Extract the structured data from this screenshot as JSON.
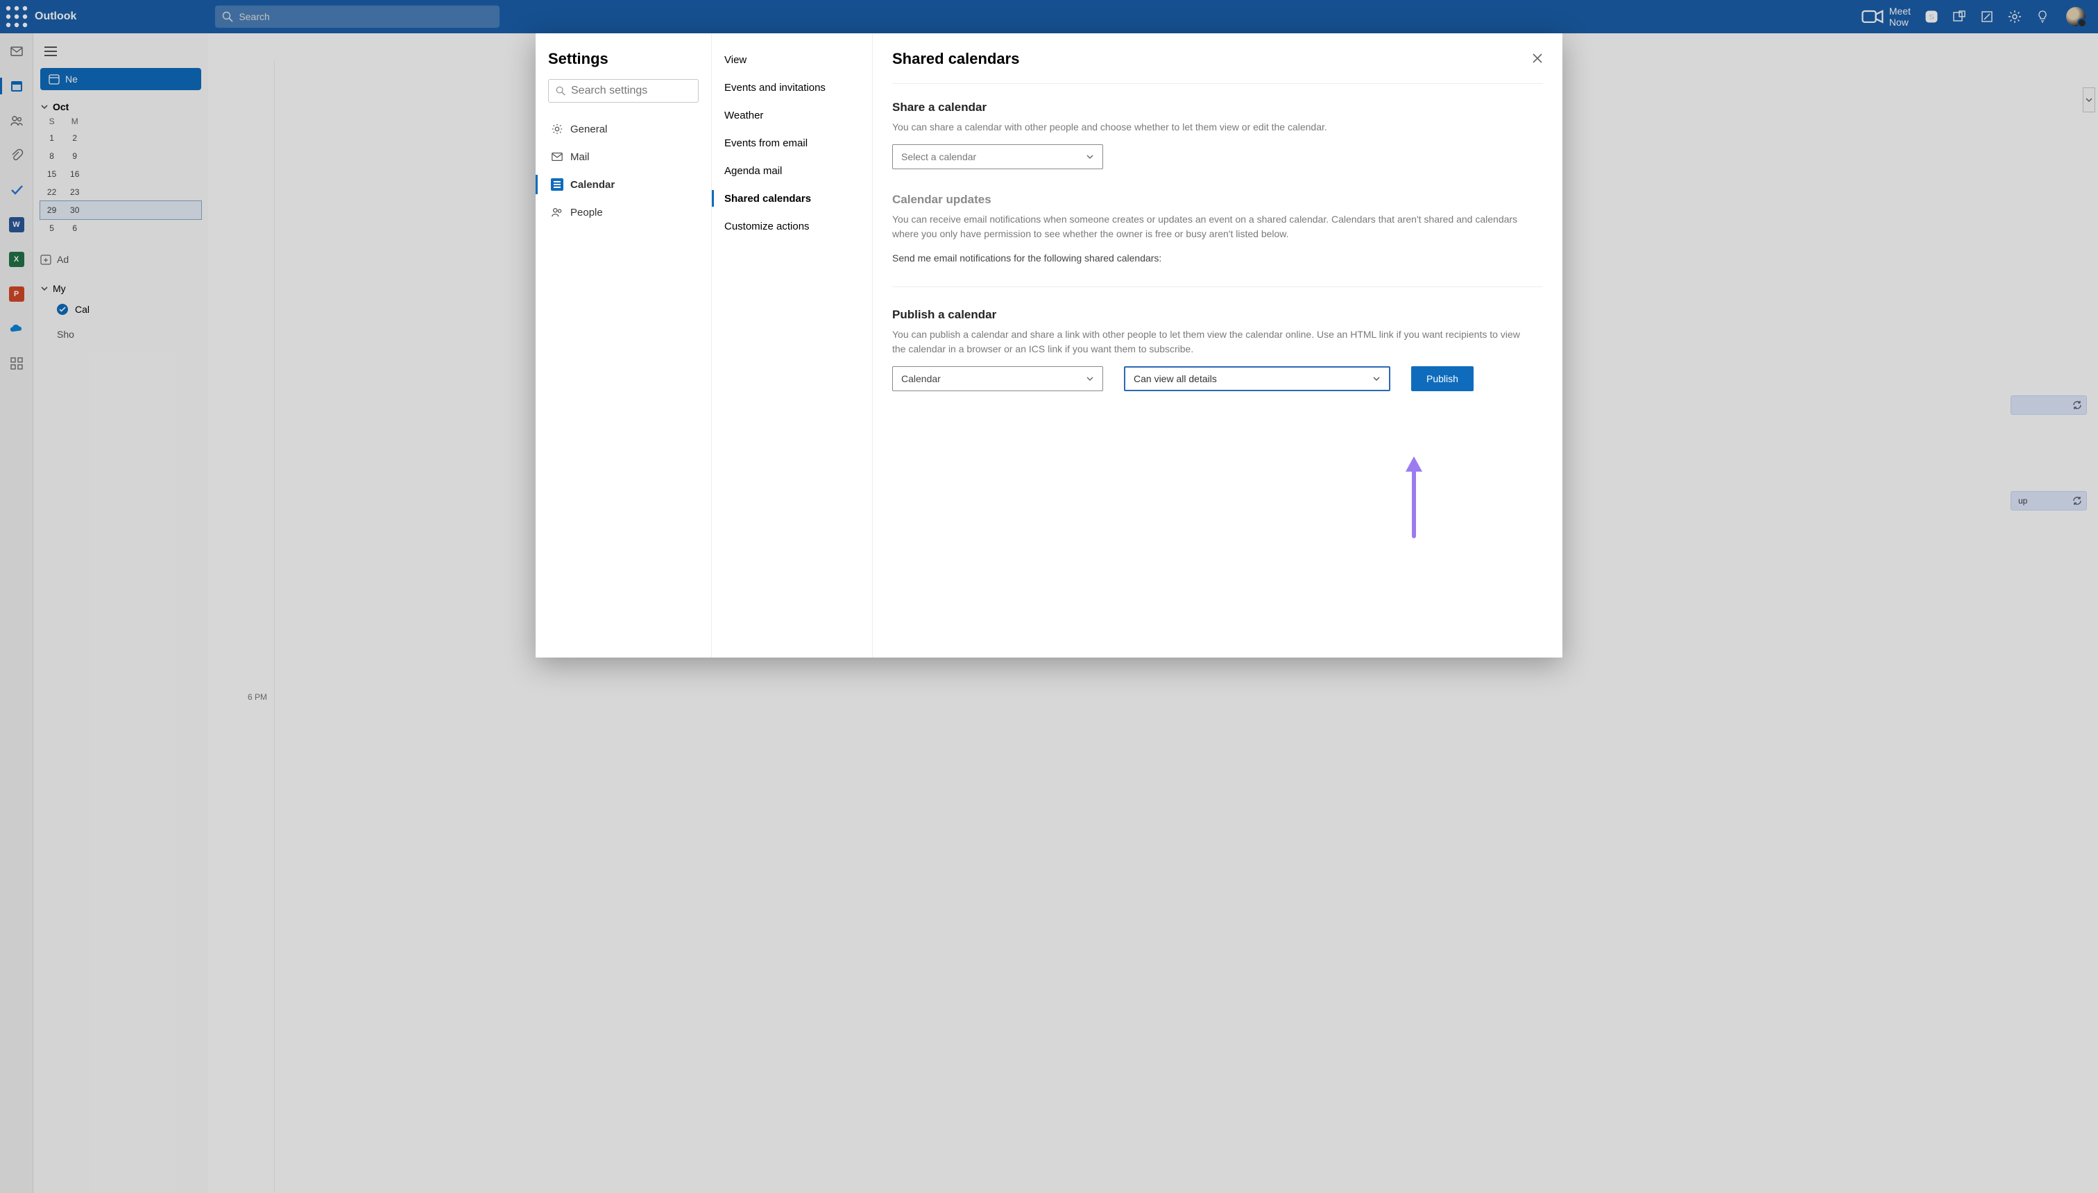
{
  "top": {
    "brand": "Outlook",
    "search_placeholder": "Search",
    "meet_now": "Meet Now"
  },
  "bg": {
    "new_button": "Ne",
    "month_label": "Oct",
    "dow": [
      "S",
      "M"
    ],
    "weeks": [
      [
        "1",
        "2"
      ],
      [
        "8",
        "9"
      ],
      [
        "15",
        "16"
      ],
      [
        "22",
        "23"
      ],
      [
        "29",
        "30"
      ],
      [
        "5",
        "6"
      ]
    ],
    "add_calendar": "Ad",
    "my_calendars": "My",
    "calendar_item": "Cal",
    "show_all": "Sho",
    "time_6pm": "6 PM",
    "event_chip": "up"
  },
  "settings": {
    "title": "Settings",
    "search_placeholder": "Search settings",
    "nav": {
      "general": "General",
      "mail": "Mail",
      "calendar": "Calendar",
      "people": "People"
    },
    "mid": {
      "view": "View",
      "events_invitations": "Events and invitations",
      "weather": "Weather",
      "events_from_email": "Events from email",
      "agenda_mail": "Agenda mail",
      "shared_calendars": "Shared calendars",
      "customize_actions": "Customize actions"
    },
    "main": {
      "title": "Shared calendars",
      "share": {
        "heading": "Share a calendar",
        "desc": "You can share a calendar with other people and choose whether to let them view or edit the calendar.",
        "select_placeholder": "Select a calendar"
      },
      "updates": {
        "heading": "Calendar updates",
        "desc": "You can receive email notifications when someone creates or updates an event on a shared calendar. Calendars that aren't shared and calendars where you only have permission to see whether the owner is free or busy aren't listed below.",
        "send_me": "Send me email notifications for the following shared calendars:"
      },
      "publish": {
        "heading": "Publish a calendar",
        "desc": "You can publish a calendar and share a link with other people to let them view the calendar online. Use an HTML link if you want recipients to view the calendar in a browser or an ICS link if you want them to subscribe.",
        "calendar_value": "Calendar",
        "permission_value": "Can view all details",
        "button": "Publish"
      }
    }
  }
}
